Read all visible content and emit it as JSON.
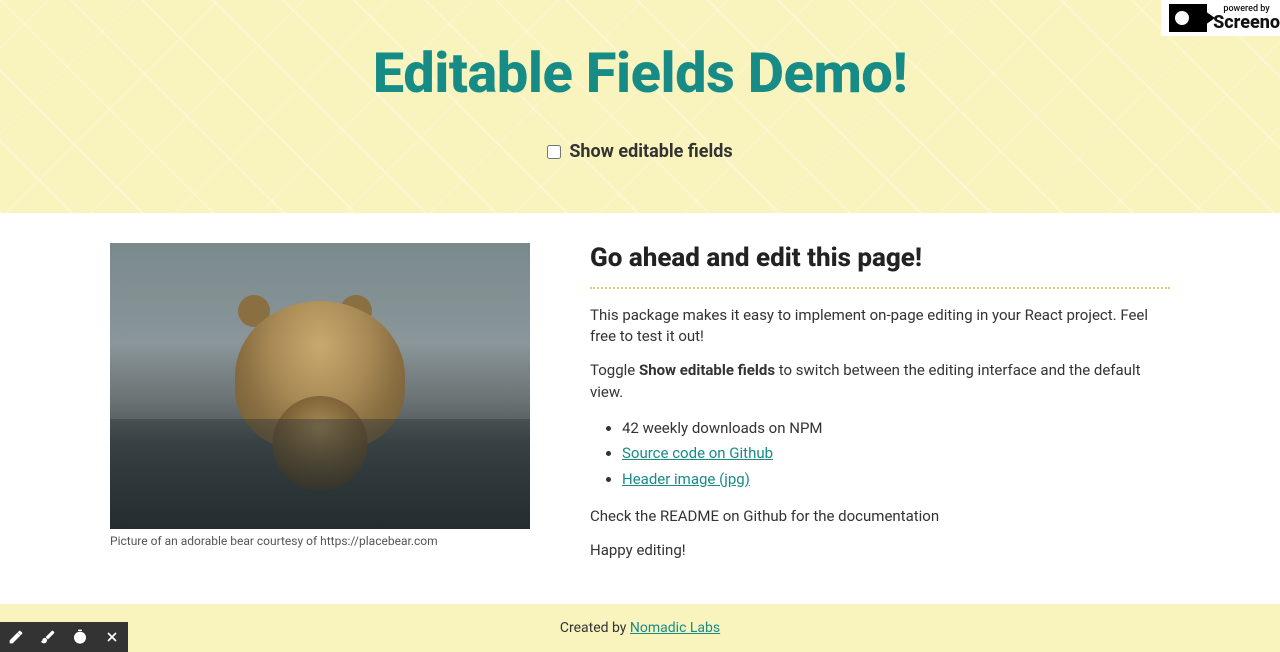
{
  "hero": {
    "title": "Editable Fields Demo!",
    "checkbox_label": "Show editable fields",
    "checkbox_checked": false
  },
  "badge": {
    "small_text": "powered by",
    "brand_text": "Screeno"
  },
  "image": {
    "caption": "Picture of an adorable bear courtesy of https://placebear.com"
  },
  "main": {
    "heading": "Go ahead and edit this page!",
    "para1": "This package makes it easy to implement on-page editing in your React project. Feel free to test it out!",
    "para2_prefix": "Toggle ",
    "para2_bold": "Show editable fields",
    "para2_suffix": " to switch between the editing interface and the default view.",
    "list": {
      "item1": "42 weekly downloads on NPM",
      "item2": "Source code on Github",
      "item3": "Header image (jpg)"
    },
    "para3": "Check the README on Github for the documentation",
    "para4": "Happy editing!"
  },
  "footer": {
    "prefix": "Created by ",
    "link_text": "Nomadic Labs"
  },
  "toolbar": {
    "pencil": "edit",
    "brush": "draw",
    "timer": "timer",
    "close": "close"
  }
}
